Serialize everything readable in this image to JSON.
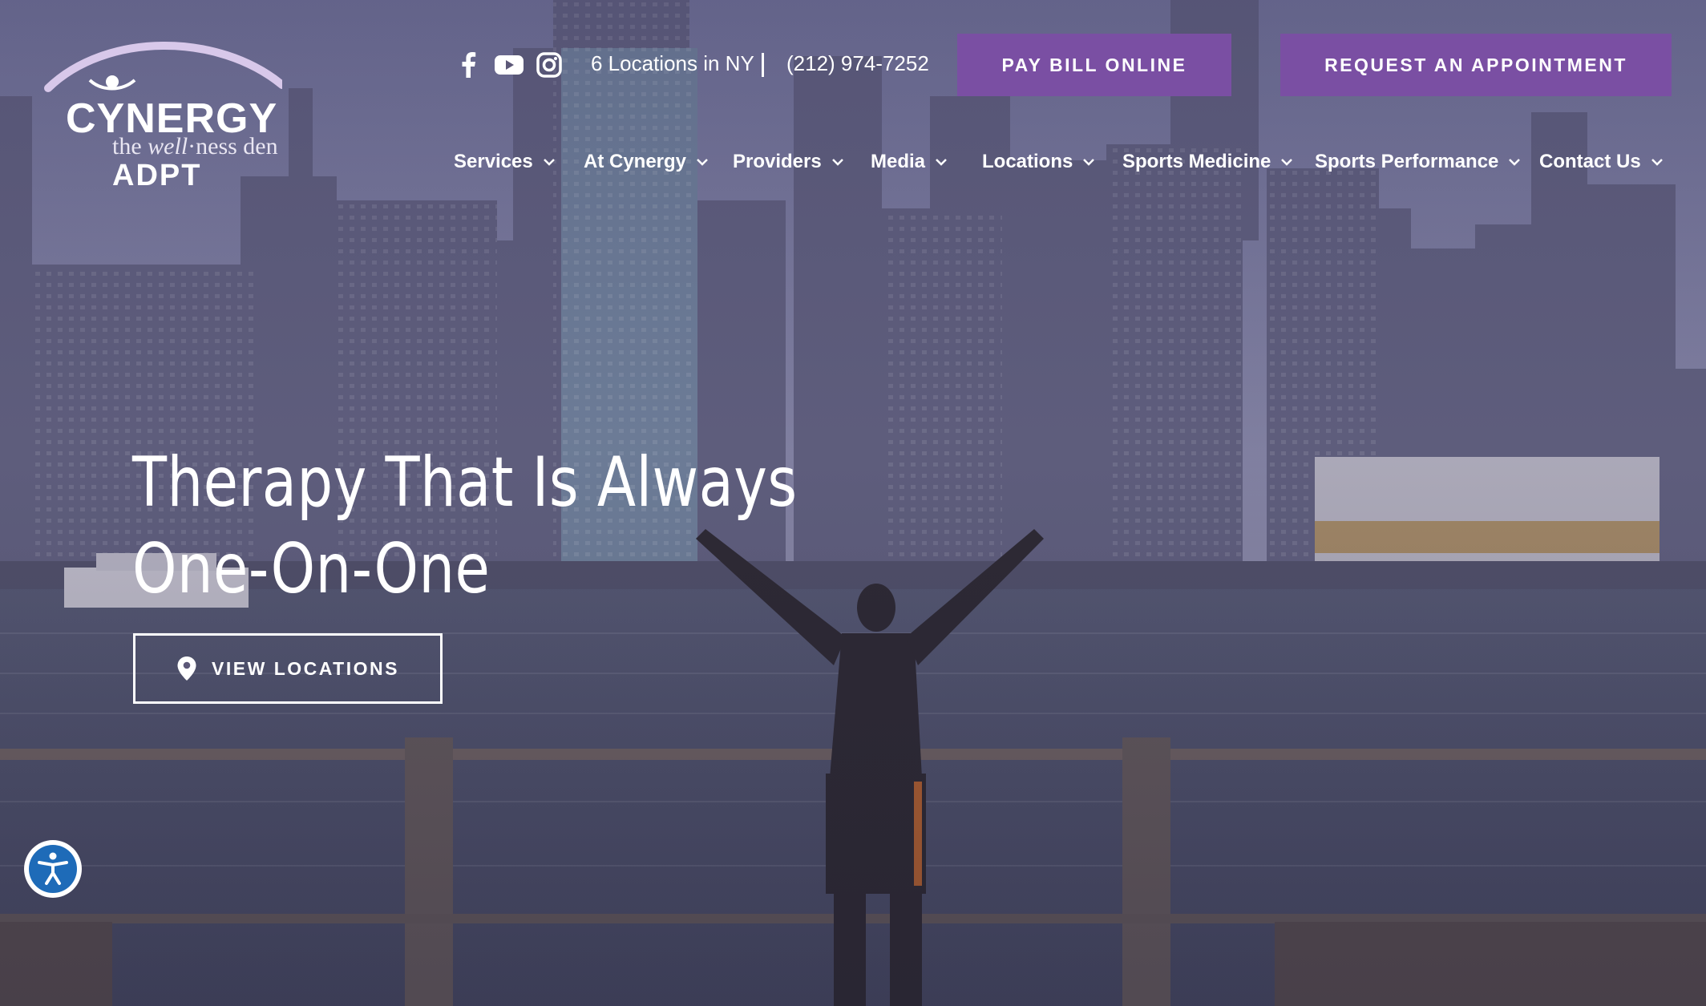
{
  "logo": {
    "brand": "CYNERGY",
    "tagline_start": "the ",
    "tagline_italic": "well",
    "tagline_end": "·ness den",
    "sub_brand": "ADPT"
  },
  "topbar": {
    "social_icons": [
      "facebook-icon",
      "youtube-icon",
      "instagram-icon"
    ],
    "locations_text": "6 Locations in NY",
    "phone": "(212) 974-7252",
    "pay_bill_label": "PAY BILL ONLINE",
    "request_label": "REQUEST AN APPOINTMENT"
  },
  "nav": {
    "items": [
      {
        "label": "Services"
      },
      {
        "label": "At Cynergy"
      },
      {
        "label": "Providers"
      },
      {
        "label": "Media"
      },
      {
        "label": "Locations"
      },
      {
        "label": "Sports Medicine"
      },
      {
        "label": "Sports Performance"
      },
      {
        "label": "Contact Us"
      }
    ]
  },
  "hero": {
    "headline_line1": "Therapy That Is Always",
    "headline_line2": "One-On-One",
    "button_label": "VIEW LOCATIONS"
  },
  "colors": {
    "accent": "#7a4fa3",
    "accessibility_blue": "#1e6bb8"
  }
}
